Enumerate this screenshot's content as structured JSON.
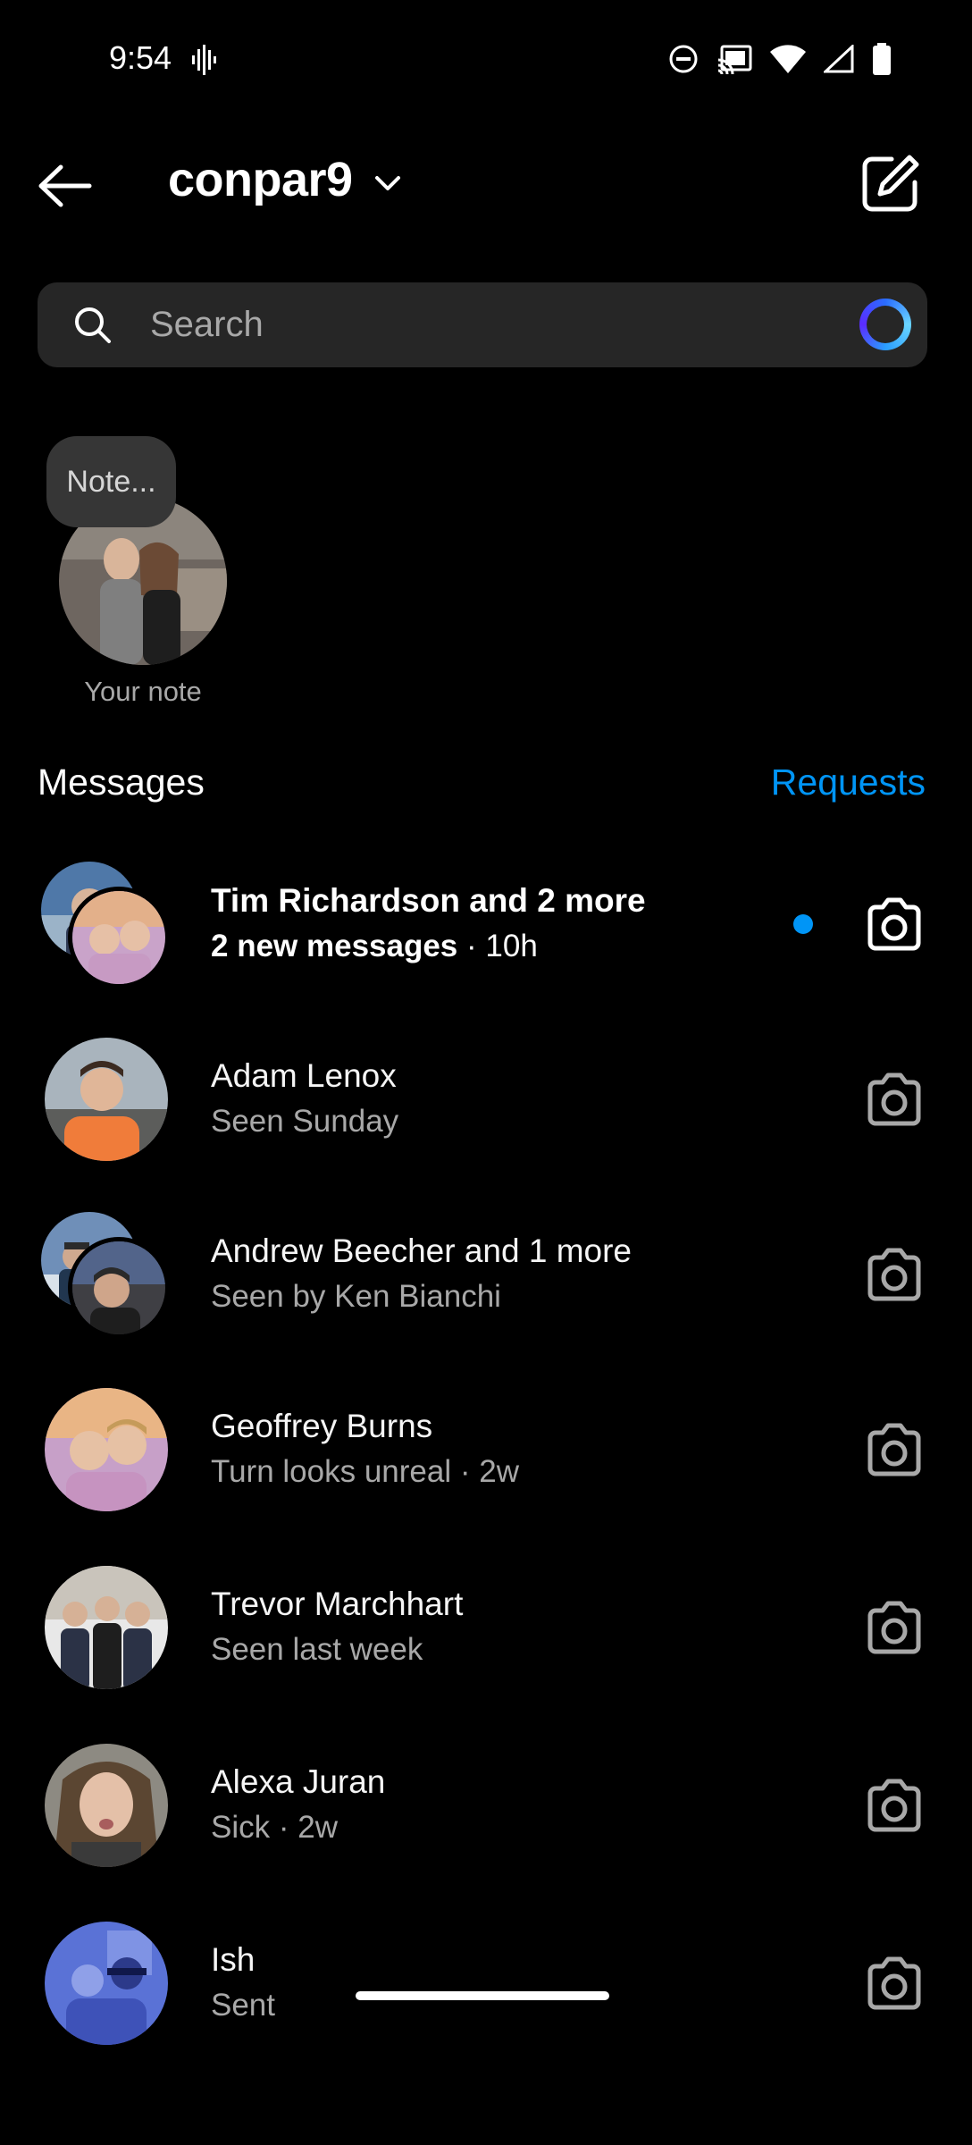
{
  "status_bar": {
    "time": "9:54"
  },
  "header": {
    "username": "conpar9"
  },
  "search": {
    "placeholder": "Search"
  },
  "note": {
    "bubble_text": "Note...",
    "label": "Your note"
  },
  "section": {
    "title": "Messages",
    "requests_label": "Requests"
  },
  "threads": [
    {
      "name": "Tim Richardson and 2 more",
      "preview": "2 new messages",
      "time": "· 10h",
      "unread": true,
      "group": true
    },
    {
      "name": "Adam Lenox",
      "preview": "Seen Sunday",
      "time": "",
      "unread": false,
      "group": false
    },
    {
      "name": "Andrew Beecher and 1 more",
      "preview": "Seen by Ken Bianchi",
      "time": "",
      "unread": false,
      "group": true
    },
    {
      "name": "Geoffrey Burns",
      "preview": "Turn looks unreal",
      "time": "· 2w",
      "unread": false,
      "group": false
    },
    {
      "name": "Trevor Marchhart",
      "preview": "Seen last week",
      "time": "",
      "unread": false,
      "group": false
    },
    {
      "name": "Alexa Juran",
      "preview": "Sick",
      "time": "· 2w",
      "unread": false,
      "group": false
    },
    {
      "name": "Ish",
      "preview": "Sent",
      "time": "",
      "unread": false,
      "group": false
    }
  ],
  "colors": {
    "accent": "#0095f6",
    "background": "#000000",
    "secondary_text": "#a8a8a8",
    "search_bg": "#262626"
  }
}
